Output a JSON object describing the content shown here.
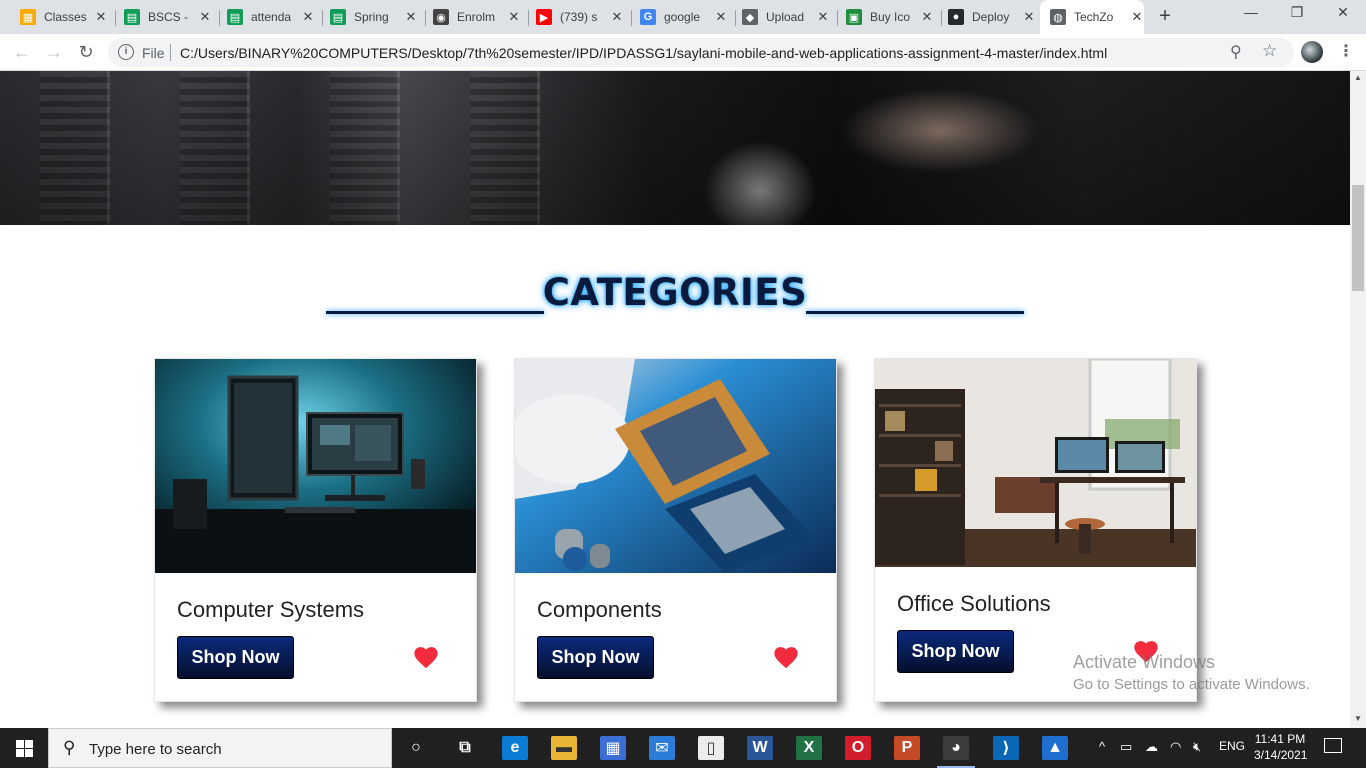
{
  "browser": {
    "tabs": [
      {
        "label": "Classes",
        "icon": "google-classroom-icon",
        "color": "#f9ab00",
        "glyph": "▦"
      },
      {
        "label": "BSCS -",
        "icon": "google-sheets-icon",
        "color": "#0f9d58",
        "glyph": "▤"
      },
      {
        "label": "attenda",
        "icon": "google-sheets-icon",
        "color": "#0f9d58",
        "glyph": "▤"
      },
      {
        "label": "Spring",
        "icon": "google-sheets-icon",
        "color": "#0f9d58",
        "glyph": "▤"
      },
      {
        "label": "Enrolm",
        "icon": "portal-icon",
        "color": "#444444",
        "glyph": "◉"
      },
      {
        "label": "(739) s",
        "icon": "youtube-icon",
        "color": "#ff0000",
        "glyph": "▶"
      },
      {
        "label": "google",
        "icon": "google-icon",
        "color": "#4285f4",
        "glyph": "G"
      },
      {
        "label": "Upload",
        "icon": "upload-icon",
        "color": "#5f6368",
        "glyph": "◆"
      },
      {
        "label": "Buy Ico",
        "icon": "icon-store-icon",
        "color": "#1e8e3e",
        "glyph": "▣"
      },
      {
        "label": "Deploy",
        "icon": "github-icon",
        "color": "#24292e",
        "glyph": "●"
      },
      {
        "label": "TechZo",
        "icon": "globe-icon",
        "color": "#5f6368",
        "glyph": "◍",
        "active": true
      }
    ],
    "new_tab_symbol": "+",
    "window_controls": {
      "minimize": "—",
      "maximize": "❐",
      "close": "✕"
    },
    "nav": {
      "back": "←",
      "forward": "→",
      "reload": "↻"
    },
    "address": {
      "info_symbol": "i",
      "scheme_label": "File",
      "url": "C:/Users/BINARY%20COMPUTERS/Desktop/7th%20semester/IPD/IPDASSG1/saylani-mobile-and-web-applications-assignment-4-master/index.html"
    },
    "zoom_symbol": "⚲",
    "bookmark_symbol": "☆",
    "menu_symbol": "⋮"
  },
  "page": {
    "section_title": "CATEGORIES",
    "categories": [
      {
        "name": "Computer Systems",
        "button": "Shop Now",
        "image": "desk-setup-monitors"
      },
      {
        "name": "Components",
        "button": "Shop Now",
        "image": "cpu-motherboard"
      },
      {
        "name": "Office Solutions",
        "button": "Shop Now",
        "image": "home-office-bookshelf"
      }
    ],
    "heart_color": "#f22b3d",
    "button_color": "#081a4d",
    "title_color": "#0a1a3c",
    "glow_color": "#0096ff"
  },
  "watermark": {
    "line1": "Activate Windows",
    "line2": "Go to Settings to activate Windows."
  },
  "taskbar": {
    "search_placeholder": "Type here to search",
    "pinned": [
      {
        "name": "cortana-icon",
        "glyph": "○"
      },
      {
        "name": "task-view-icon",
        "glyph": "⧉"
      },
      {
        "name": "edge-icon",
        "glyph": "e"
      },
      {
        "name": "file-explorer-icon",
        "glyph": "▬"
      },
      {
        "name": "store-icon",
        "glyph": "▦"
      },
      {
        "name": "mail-icon",
        "glyph": "✉"
      },
      {
        "name": "notepad-icon",
        "glyph": "▯"
      },
      {
        "name": "word-icon",
        "glyph": "W"
      },
      {
        "name": "excel-icon",
        "glyph": "X"
      },
      {
        "name": "opera-icon",
        "glyph": "O"
      },
      {
        "name": "powerpoint-icon",
        "glyph": "P"
      },
      {
        "name": "chrome-icon",
        "glyph": "◕"
      },
      {
        "name": "vscode-icon",
        "glyph": "⟩"
      },
      {
        "name": "photos-icon",
        "glyph": "▲"
      }
    ],
    "tray": {
      "chevron": "^",
      "language": "ENG",
      "time": "11:41 PM",
      "date": "3/14/2021"
    }
  }
}
